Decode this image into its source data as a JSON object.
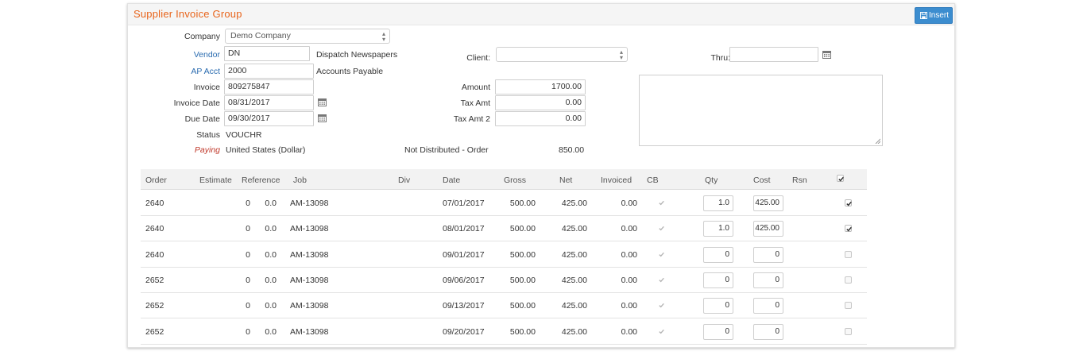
{
  "header": {
    "title": "Supplier Invoice Group",
    "insert_label": "Insert"
  },
  "form": {
    "company_label": "Company",
    "company_value": "Demo Company",
    "vendor_label": "Vendor",
    "vendor_value": "DN",
    "vendor_name": "Dispatch Newspapers",
    "ap_label": "AP Acct",
    "ap_value": "2000",
    "ap_name": "Accounts Payable",
    "invoice_label": "Invoice",
    "invoice_value": "809275847",
    "invoice_date_label": "Invoice Date",
    "invoice_date_value": "08/31/2017",
    "due_date_label": "Due Date",
    "due_date_value": "09/30/2017",
    "status_label": "Status",
    "status_value": "VOUCHR",
    "paying_label": "Paying",
    "paying_value": "United States (Dollar)",
    "client_label": "Client:",
    "client_value": "",
    "thru_label": "Thru:",
    "thru_value": "",
    "amount_label": "Amount",
    "amount_value": "1700.00",
    "tax_label": "Tax Amt",
    "tax_value": "0.00",
    "tax2_label": "Tax Amt 2",
    "tax2_value": "0.00",
    "not_dist_label": "Not Distributed - Order",
    "not_dist_value": "850.00",
    "notes_value": ""
  },
  "table": {
    "headers": {
      "order": "Order",
      "estimate": "Estimate",
      "reference": "Reference",
      "job": "Job",
      "div": "Div",
      "date": "Date",
      "gross": "Gross",
      "net": "Net",
      "invoiced": "Invoiced",
      "cb": "CB",
      "qty": "Qty",
      "cost": "Cost",
      "rsn": "Rsn"
    },
    "header_checked": true,
    "rows": [
      {
        "order": "2640",
        "estimate": "0",
        "reference": "0.0",
        "job": "AM-13098",
        "div": "",
        "date": "07/01/2017",
        "gross": "500.00",
        "net": "425.00",
        "invoiced": "0.00",
        "qty": "1.0",
        "cost": "425.00",
        "rsn": "",
        "selected": true
      },
      {
        "order": "2640",
        "estimate": "0",
        "reference": "0.0",
        "job": "AM-13098",
        "div": "",
        "date": "08/01/2017",
        "gross": "500.00",
        "net": "425.00",
        "invoiced": "0.00",
        "qty": "1.0",
        "cost": "425.00",
        "rsn": "",
        "selected": true
      },
      {
        "order": "2640",
        "estimate": "0",
        "reference": "0.0",
        "job": "AM-13098",
        "div": "",
        "date": "09/01/2017",
        "gross": "500.00",
        "net": "425.00",
        "invoiced": "0.00",
        "qty": "0",
        "cost": "0",
        "rsn": "",
        "selected": false
      },
      {
        "order": "2652",
        "estimate": "0",
        "reference": "0.0",
        "job": "AM-13098",
        "div": "",
        "date": "09/06/2017",
        "gross": "500.00",
        "net": "425.00",
        "invoiced": "0.00",
        "qty": "0",
        "cost": "0",
        "rsn": "",
        "selected": false
      },
      {
        "order": "2652",
        "estimate": "0",
        "reference": "0.0",
        "job": "AM-13098",
        "div": "",
        "date": "09/13/2017",
        "gross": "500.00",
        "net": "425.00",
        "invoiced": "0.00",
        "qty": "0",
        "cost": "0",
        "rsn": "",
        "selected": false
      },
      {
        "order": "2652",
        "estimate": "0",
        "reference": "0.0",
        "job": "AM-13098",
        "div": "",
        "date": "09/20/2017",
        "gross": "500.00",
        "net": "425.00",
        "invoiced": "0.00",
        "qty": "0",
        "cost": "0",
        "rsn": "",
        "selected": false
      }
    ]
  },
  "colors": {
    "title": "#e8641b",
    "accent": "#3c8dcf",
    "link": "#2b6cb0",
    "paying": "#c0392b"
  },
  "icons": [
    "save-icon",
    "calendar-icon",
    "chevron-updown-icon",
    "check-icon",
    "resize-grip-icon"
  ]
}
